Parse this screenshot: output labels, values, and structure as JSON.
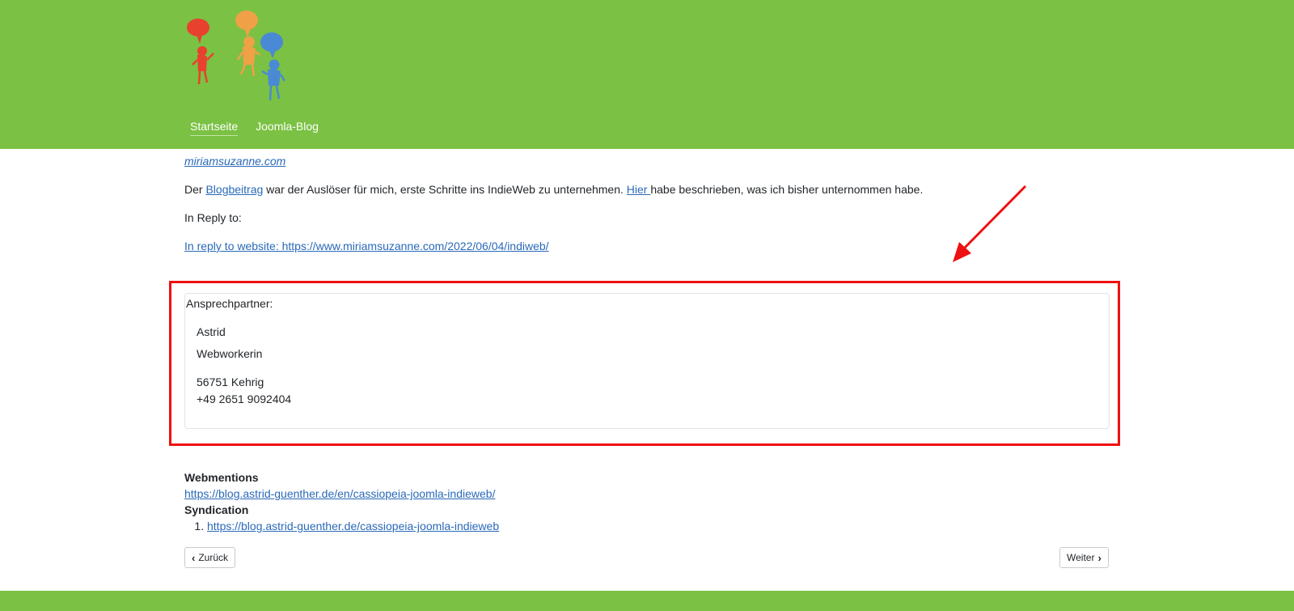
{
  "header": {
    "logo_name": "speech-bubble-people-logo",
    "nav": [
      {
        "label": "Startseite",
        "active": true
      },
      {
        "label": "Joomla-Blog",
        "active": false
      }
    ]
  },
  "article": {
    "source_link": "miriamsuzanne.com",
    "paragraph": {
      "prefix": "Der ",
      "link1": "Blogbeitrag",
      "middle": " war der Auslöser für mich, erste Schritte ins IndieWeb zu unternehmen. ",
      "link2": "Hier ",
      "suffix": "habe beschrieben, was ich bisher unternommen habe."
    },
    "reply_label": "In Reply to:",
    "reply_link": "In reply to website: https://www.miriamsuzanne.com/2022/06/04/indiweb/"
  },
  "contact": {
    "legend": "Ansprechpartner:",
    "name": "Astrid",
    "position": "Webworkerin",
    "city": "56751 Kehrig",
    "phone": "+49 2651 9092404"
  },
  "webmentions": {
    "heading": "Webmentions",
    "link": "https://blog.astrid-guenther.de/en/cassiopeia-joomla-indieweb/"
  },
  "syndication": {
    "heading": "Syndication",
    "items": [
      "https://blog.astrid-guenther.de/cassiopeia-joomla-indieweb"
    ]
  },
  "pagination": {
    "prev_label": "Zurück",
    "next_label": "Weiter"
  },
  "colors": {
    "header_green": "#7bc143",
    "link_blue": "#2a69b8",
    "annotation_red": "#ee1111"
  }
}
